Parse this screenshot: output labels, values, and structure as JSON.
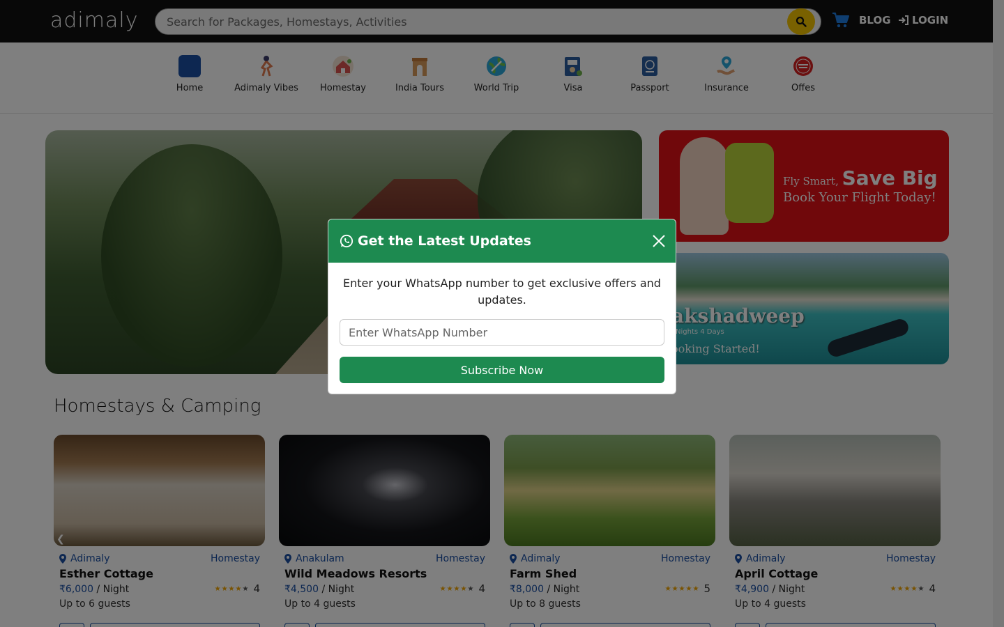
{
  "header": {
    "logo": "adimaly",
    "search_placeholder": "Search for Packages, Homestays, Activities",
    "blog_label": "BLOG",
    "login_label": "LOGIN"
  },
  "categories": [
    {
      "label": "Home",
      "icon": "home-icon",
      "color": "#1a4fa3"
    },
    {
      "label": "Adimaly Vibes",
      "icon": "dancer-icon",
      "color": "#e07a4f"
    },
    {
      "label": "Homestay",
      "icon": "house-icon",
      "color": "#d9534f"
    },
    {
      "label": "India Tours",
      "icon": "india-gate-icon",
      "color": "#c27a3a"
    },
    {
      "label": "World Trip",
      "icon": "globe-plane-icon",
      "color": "#2aa6d8"
    },
    {
      "label": "Visa",
      "icon": "visa-icon",
      "color": "#2b5d9e"
    },
    {
      "label": "Passport",
      "icon": "passport-icon",
      "color": "#2b5d9e"
    },
    {
      "label": "Insurance",
      "icon": "insurance-icon",
      "color": "#2aa6d8"
    },
    {
      "label": "Offes",
      "icon": "offer-badge-icon",
      "color": "#d62020"
    }
  ],
  "promos": {
    "flight": {
      "line1_small": "Fly Smart,",
      "line1_big": "Save Big",
      "line2": "Book Your Flight Today!"
    },
    "lakshadweep": {
      "title": "akshadweep",
      "duration": "Nights 4 Days",
      "cta": "ooking Started!"
    }
  },
  "section": {
    "title": "Homestays & Camping"
  },
  "cards": [
    {
      "location": "Adimaly",
      "type": "Homestay",
      "name": "Esther Cottage",
      "price": "₹6,000",
      "per": " / Night",
      "rating": "4",
      "stars_on": 4,
      "guests": "Up to 6 guests"
    },
    {
      "location": "Anakulam",
      "type": "Homestay",
      "name": "Wild Meadows Resorts",
      "price": "₹4,500",
      "per": " / Night",
      "rating": "4",
      "stars_on": 4,
      "guests": "Up to 4 guests"
    },
    {
      "location": "Adimaly",
      "type": "Homestay",
      "name": "Farm Shed",
      "price": "₹8,000",
      "per": " / Night",
      "rating": "5",
      "stars_on": 5,
      "guests": "Up to 8 guests"
    },
    {
      "location": "Adimaly",
      "type": "Homestay",
      "name": "April Cottage",
      "price": "₹4,900",
      "per": " / Night",
      "rating": "4",
      "stars_on": 4,
      "guests": "Up to 4 guests"
    }
  ],
  "modal": {
    "title": "Get the Latest Updates",
    "text": "Enter your WhatsApp number to get exclusive offers and updates.",
    "input_placeholder": "Enter WhatsApp Number",
    "button": "Subscribe Now"
  },
  "colors": {
    "accent_green": "#1d8a50",
    "link_blue": "#1a4fa3",
    "search_yellow": "#f2c200",
    "promo_red": "#e01017"
  }
}
